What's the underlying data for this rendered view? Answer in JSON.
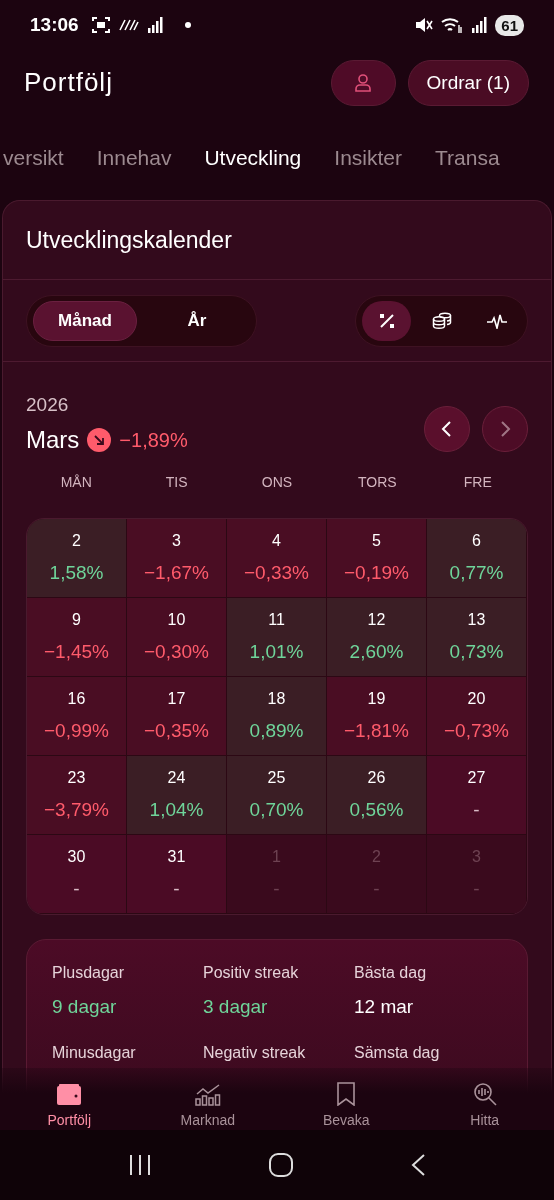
{
  "status_bar": {
    "time": "13:06",
    "battery": "61"
  },
  "header": {
    "title": "Portfölj",
    "orders_button": "Ordrar (1)"
  },
  "tabs": [
    {
      "label": "versikt",
      "selected": false
    },
    {
      "label": "Innehav",
      "selected": false
    },
    {
      "label": "Utveckling",
      "selected": true
    },
    {
      "label": "Insikter",
      "selected": false
    },
    {
      "label": "Transa",
      "selected": false
    }
  ],
  "calendar": {
    "title": "Utvecklingskalender",
    "period_toggle": [
      {
        "label": "Månad",
        "selected": true
      },
      {
        "label": "År",
        "selected": false
      }
    ],
    "mode_toggle": [
      {
        "kind": "percent",
        "selected": true
      },
      {
        "kind": "coins",
        "selected": false
      },
      {
        "kind": "pulse",
        "selected": false
      }
    ],
    "year": "2026",
    "month": "Mars",
    "month_change": {
      "kind": "down",
      "text": "−1,89%"
    },
    "month_nav": [
      {
        "kind": "prev",
        "disabled": false
      },
      {
        "kind": "next",
        "disabled": true
      }
    ],
    "weekdays": [
      "MÅN",
      "TIS",
      "ONS",
      "TORS",
      "FRE"
    ],
    "days": [
      {
        "day": "2",
        "value": "1,58%",
        "kind": "positive"
      },
      {
        "day": "3",
        "value": "−1,67%",
        "kind": "negative"
      },
      {
        "day": "4",
        "value": "−0,33%",
        "kind": "negative"
      },
      {
        "day": "5",
        "value": "−0,19%",
        "kind": "negative"
      },
      {
        "day": "6",
        "value": "0,77%",
        "kind": "positive"
      },
      {
        "day": "9",
        "value": "−1,45%",
        "kind": "negative"
      },
      {
        "day": "10",
        "value": "−0,30%",
        "kind": "negative"
      },
      {
        "day": "11",
        "value": "1,01%",
        "kind": "positive"
      },
      {
        "day": "12",
        "value": "2,60%",
        "kind": "positive"
      },
      {
        "day": "13",
        "value": "0,73%",
        "kind": "positive"
      },
      {
        "day": "16",
        "value": "−0,99%",
        "kind": "negative"
      },
      {
        "day": "17",
        "value": "−0,35%",
        "kind": "negative"
      },
      {
        "day": "18",
        "value": "0,89%",
        "kind": "positive"
      },
      {
        "day": "19",
        "value": "−1,81%",
        "kind": "negative"
      },
      {
        "day": "20",
        "value": "−0,73%",
        "kind": "negative"
      },
      {
        "day": "23",
        "value": "−3,79%",
        "kind": "negative"
      },
      {
        "day": "24",
        "value": "1,04%",
        "kind": "positive"
      },
      {
        "day": "25",
        "value": "0,70%",
        "kind": "positive"
      },
      {
        "day": "26",
        "value": "0,56%",
        "kind": "positive"
      },
      {
        "day": "27",
        "value": "-",
        "kind": "empty"
      },
      {
        "day": "30",
        "value": "-",
        "kind": "empty"
      },
      {
        "day": "31",
        "value": "-",
        "kind": "empty"
      },
      {
        "day": "1",
        "value": "-",
        "kind": "outside"
      },
      {
        "day": "2",
        "value": "-",
        "kind": "outside"
      },
      {
        "day": "3",
        "value": "-",
        "kind": "outside"
      }
    ]
  },
  "stats": [
    {
      "label": "Plusdagar",
      "value": "9 dagar",
      "kind": "positive"
    },
    {
      "label": "Positiv streak",
      "value": "3 dagar",
      "kind": "positive"
    },
    {
      "label": "Bästa dag",
      "value": "12 mar",
      "kind": "neutral"
    },
    {
      "label": "Minusdagar"
    },
    {
      "label": "Negativ streak"
    },
    {
      "label": "Sämsta dag"
    }
  ],
  "bottom_nav": [
    {
      "label": "Portfölj",
      "kind": "wallet",
      "selected": true
    },
    {
      "label": "Marknad",
      "kind": "chart",
      "selected": false
    },
    {
      "label": "Bevaka",
      "kind": "bookmark",
      "selected": false
    },
    {
      "label": "Hitta",
      "kind": "search",
      "selected": false
    }
  ]
}
